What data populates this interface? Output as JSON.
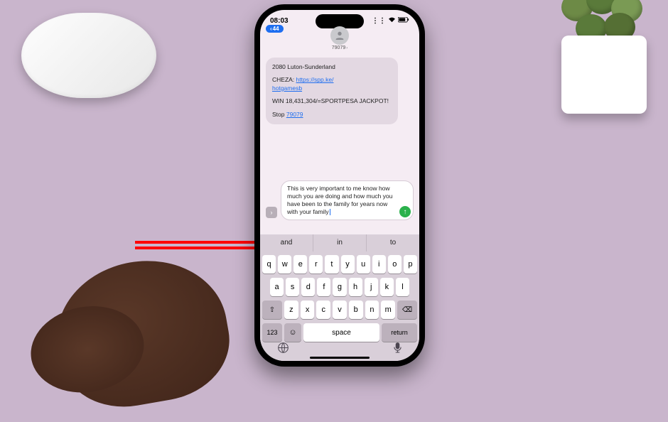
{
  "statusbar": {
    "time": "08:03"
  },
  "header": {
    "back_count": "44",
    "sender": "79079"
  },
  "message": {
    "line1": "2080 Luton-Sunderland",
    "cheza_label": "CHEZA: ",
    "link_part1": "https://spp.ke/",
    "link_part2": "hotgamesb",
    "win": "WIN 18,431,304/=SPORTPESA JACKPOT!",
    "stop_label": "Stop ",
    "stop_number": "79079"
  },
  "compose": {
    "text": "This is very important to me know how much you are doing and how much you have been to the family for years now with your family"
  },
  "predictive": {
    "s1": "and",
    "s2": "in",
    "s3": "to"
  },
  "keys": {
    "r1": [
      "q",
      "w",
      "e",
      "r",
      "t",
      "y",
      "u",
      "i",
      "o",
      "p"
    ],
    "r2": [
      "a",
      "s",
      "d",
      "f",
      "g",
      "h",
      "j",
      "k",
      "l"
    ],
    "r3": [
      "z",
      "x",
      "c",
      "v",
      "b",
      "n",
      "m"
    ],
    "num": "123",
    "space": "space",
    "return": "return"
  }
}
